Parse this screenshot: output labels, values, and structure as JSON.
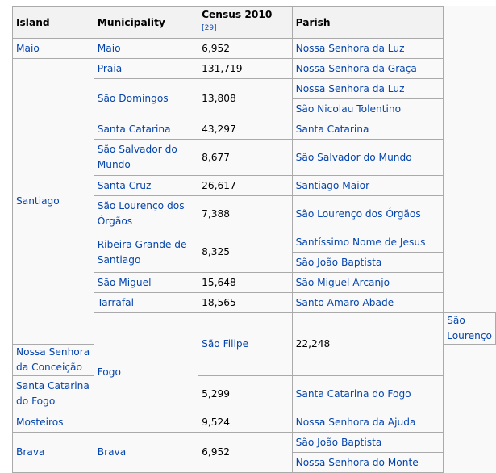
{
  "headers": {
    "island": "Island",
    "municipality": "Municipality",
    "census": "Census 2010",
    "census_ref": "[29]",
    "parish": "Parish"
  },
  "islands": {
    "maio": "Maio",
    "santiago": "Santiago",
    "fogo": "Fogo",
    "brava": "Brava"
  },
  "rows": [
    {
      "municipality": "Maio",
      "census": "6,952",
      "parishes": [
        "Nossa Senhora da Luz"
      ]
    },
    {
      "municipality": "Praia",
      "census": "131,719",
      "parishes": [
        "Nossa Senhora da Graça"
      ]
    },
    {
      "municipality": "São Domingos",
      "census": "13,808",
      "parishes": [
        "Nossa Senhora da Luz",
        "São Nicolau Tolentino"
      ]
    },
    {
      "municipality": "Santa Catarina",
      "census": "43,297",
      "parishes": [
        "Santa Catarina"
      ]
    },
    {
      "municipality": "São Salvador do Mundo",
      "census": "8,677",
      "parishes": [
        "São Salvador do Mundo"
      ]
    },
    {
      "municipality": "Santa Cruz",
      "census": "26,617",
      "parishes": [
        "Santiago Maior"
      ]
    },
    {
      "municipality": "São Lourenço dos Órgãos",
      "census": "7,388",
      "parishes": [
        "São Lourenço dos Órgãos"
      ]
    },
    {
      "municipality": "Ribeira Grande de Santiago",
      "census": "8,325",
      "parishes": [
        "Santíssimo Nome de Jesus",
        "São João Baptista"
      ]
    },
    {
      "municipality": "São Miguel",
      "census": "15,648",
      "parishes": [
        "São Miguel Arcanjo"
      ]
    },
    {
      "municipality": "Tarrafal",
      "census": "18,565",
      "parishes": [
        "Santo Amaro Abade"
      ]
    },
    {
      "municipality": "São Filipe",
      "census": "22,248",
      "parishes": [
        "São Lourenço",
        "Nossa Senhora da Conceição"
      ]
    },
    {
      "municipality": "Santa Catarina do Fogo",
      "census": "5,299",
      "parishes": [
        "Santa Catarina do Fogo"
      ]
    },
    {
      "municipality": "Mosteiros",
      "census": "9,524",
      "parishes": [
        "Nossa Senhora da Ajuda"
      ]
    },
    {
      "municipality": "Brava",
      "census": "6,952",
      "parishes": [
        "São João Baptista",
        "Nossa Senhora do Monte"
      ]
    }
  ]
}
